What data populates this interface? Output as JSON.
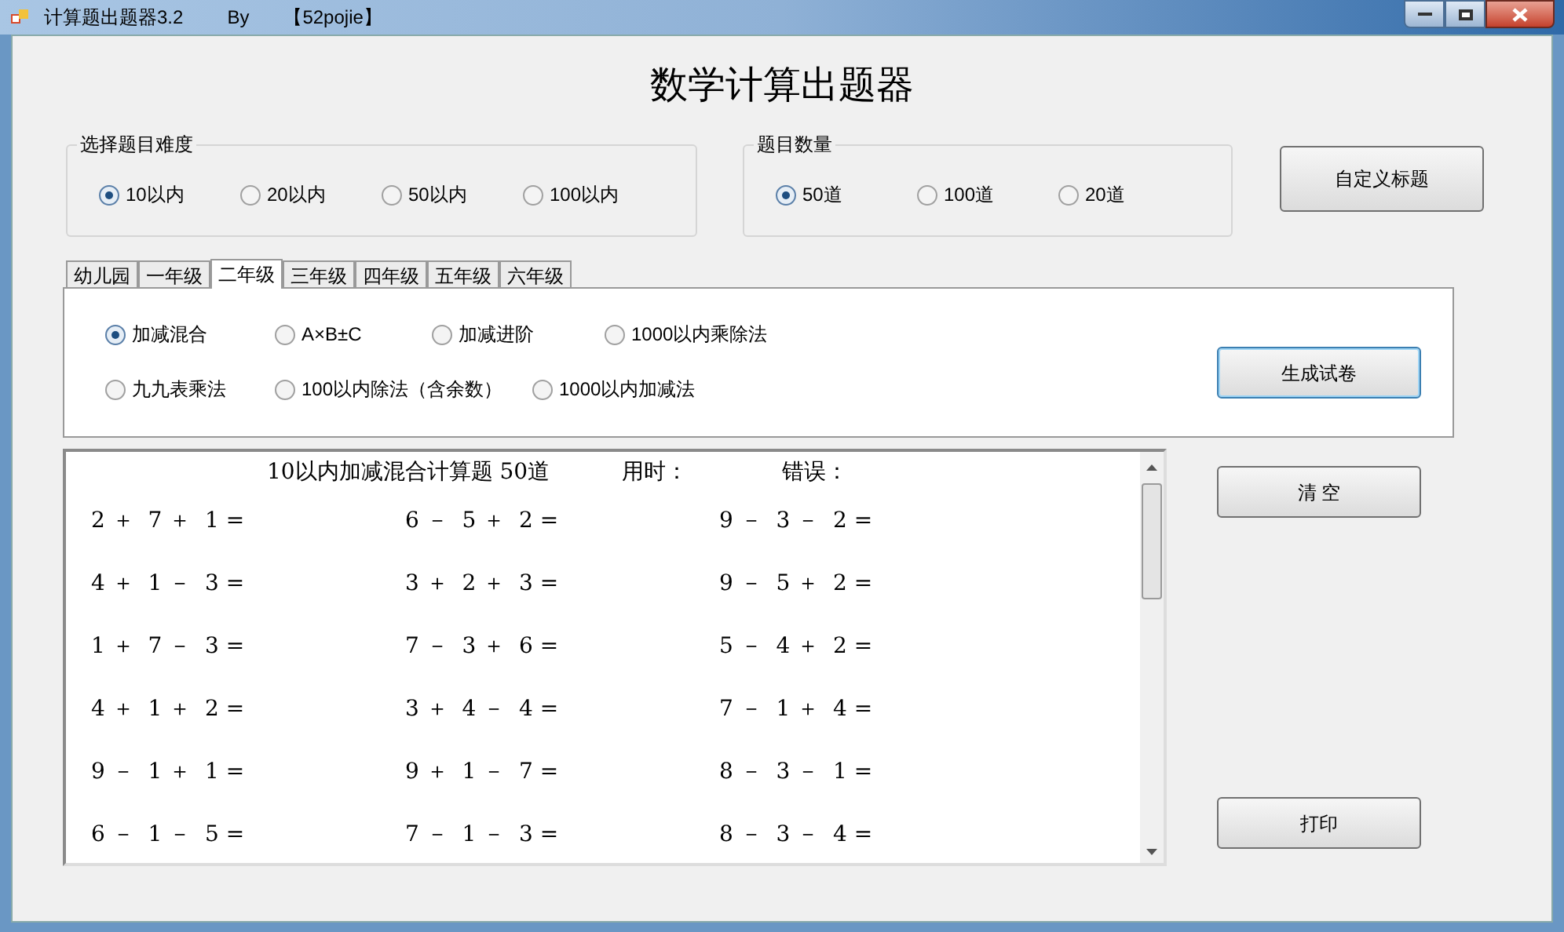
{
  "window": {
    "title": "计算题出题器3.2",
    "by": "By",
    "author": "【52pojie】"
  },
  "heading": "数学计算出题器",
  "difficulty": {
    "label": "选择题目难度",
    "options": [
      {
        "label": "10以内",
        "selected": true
      },
      {
        "label": "20以内",
        "selected": false
      },
      {
        "label": "50以内",
        "selected": false
      },
      {
        "label": "100以内",
        "selected": false
      }
    ]
  },
  "count": {
    "label": "题目数量",
    "options": [
      {
        "label": "50道",
        "selected": true
      },
      {
        "label": "100道",
        "selected": false
      },
      {
        "label": "20道",
        "selected": false
      }
    ]
  },
  "custom_title_button": "自定义标题",
  "grade_tabs": [
    {
      "label": "幼儿园",
      "selected": false
    },
    {
      "label": "一年级",
      "selected": false
    },
    {
      "label": "二年级",
      "selected": true
    },
    {
      "label": "三年级",
      "selected": false
    },
    {
      "label": "四年级",
      "selected": false
    },
    {
      "label": "五年级",
      "selected": false
    },
    {
      "label": "六年级",
      "selected": false
    }
  ],
  "question_types": [
    {
      "options": [
        {
          "label": "加减混合",
          "selected": true
        },
        {
          "label": "A×B±C",
          "selected": false
        },
        {
          "label": "加减进阶",
          "selected": false
        },
        {
          "label": "1000以内乘除法",
          "selected": false
        }
      ]
    },
    {
      "options": [
        {
          "label": "九九表乘法",
          "selected": false
        },
        {
          "label": "100以内除法（含余数）",
          "selected": false
        },
        {
          "label": "1000以内加减法",
          "selected": false
        }
      ]
    }
  ],
  "generate_button": "生成试卷",
  "clear_button": "清 空",
  "print_button": "打印",
  "worksheet": {
    "title": "10以内加减混合计算题 50道",
    "time_label": "用时：",
    "error_label": "错误：",
    "rows": [
      [
        "2 ＋  7 ＋  1 =",
        "6 －  5 ＋  2 =",
        "9 －  3 －  2 ="
      ],
      [
        "4 ＋  1 －  3 =",
        "3 ＋  2 ＋  3 =",
        "9 －  5 ＋  2 ="
      ],
      [
        "1 ＋  7 －  3 =",
        "7 －  3 ＋  6 =",
        "5 －  4 ＋  2 ="
      ],
      [
        "4 ＋  1 ＋  2 =",
        "3 ＋  4 －  4 =",
        "7 －  1 ＋  4 ="
      ],
      [
        "9 －  1 ＋  1 =",
        "9 ＋  1 －  7 =",
        "8 －  3 －  1 ="
      ],
      [
        "6 －  1 －  5 =",
        "7 －  1 －  3 =",
        "8 －  3 －  4 ="
      ]
    ]
  }
}
